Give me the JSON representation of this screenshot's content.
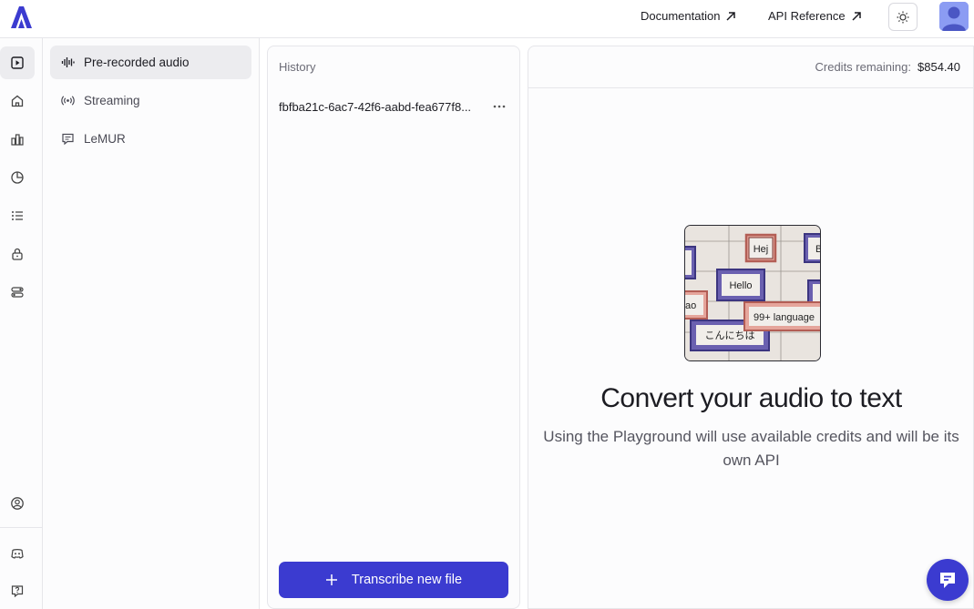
{
  "header": {
    "documentation_label": "Documentation",
    "api_reference_label": "API Reference",
    "theme_icon": "sun-icon",
    "avatar_icon": "user-avatar"
  },
  "rail": {
    "top_items": [
      "playground-icon",
      "home-icon",
      "bar-chart-icon",
      "pie-chart-icon",
      "list-icon",
      "lock-icon",
      "toggles-icon"
    ],
    "bottom_items": [
      "account-icon",
      "discord-icon",
      "help-icon"
    ]
  },
  "subnav": {
    "items": [
      {
        "label": "Pre-recorded audio",
        "icon": "waveform-icon"
      },
      {
        "label": "Streaming",
        "icon": "broadcast-icon"
      },
      {
        "label": "LeMUR",
        "icon": "chat-icon"
      }
    ]
  },
  "history": {
    "title": "History",
    "items": [
      {
        "label": "fbfba21c-6ac7-42f6-aabd-fea677f8..."
      }
    ],
    "transcribe_label": "Transcribe new file"
  },
  "main": {
    "credits_label": "Credits remaining:",
    "credits_value": "$854.40",
    "illustration": {
      "labels": [
        "Hej",
        "Hello",
        "ao",
        "99+ language",
        "こんにちは",
        "B"
      ]
    },
    "title": "Convert your audio to text",
    "subtitle": "Using the Playground will use available credits and will be its own API"
  },
  "colors": {
    "accent": "#3b3bd0",
    "logo": "#3b3bd0",
    "illustration_purple": "#6a60b0",
    "illustration_red": "#c98a84"
  }
}
